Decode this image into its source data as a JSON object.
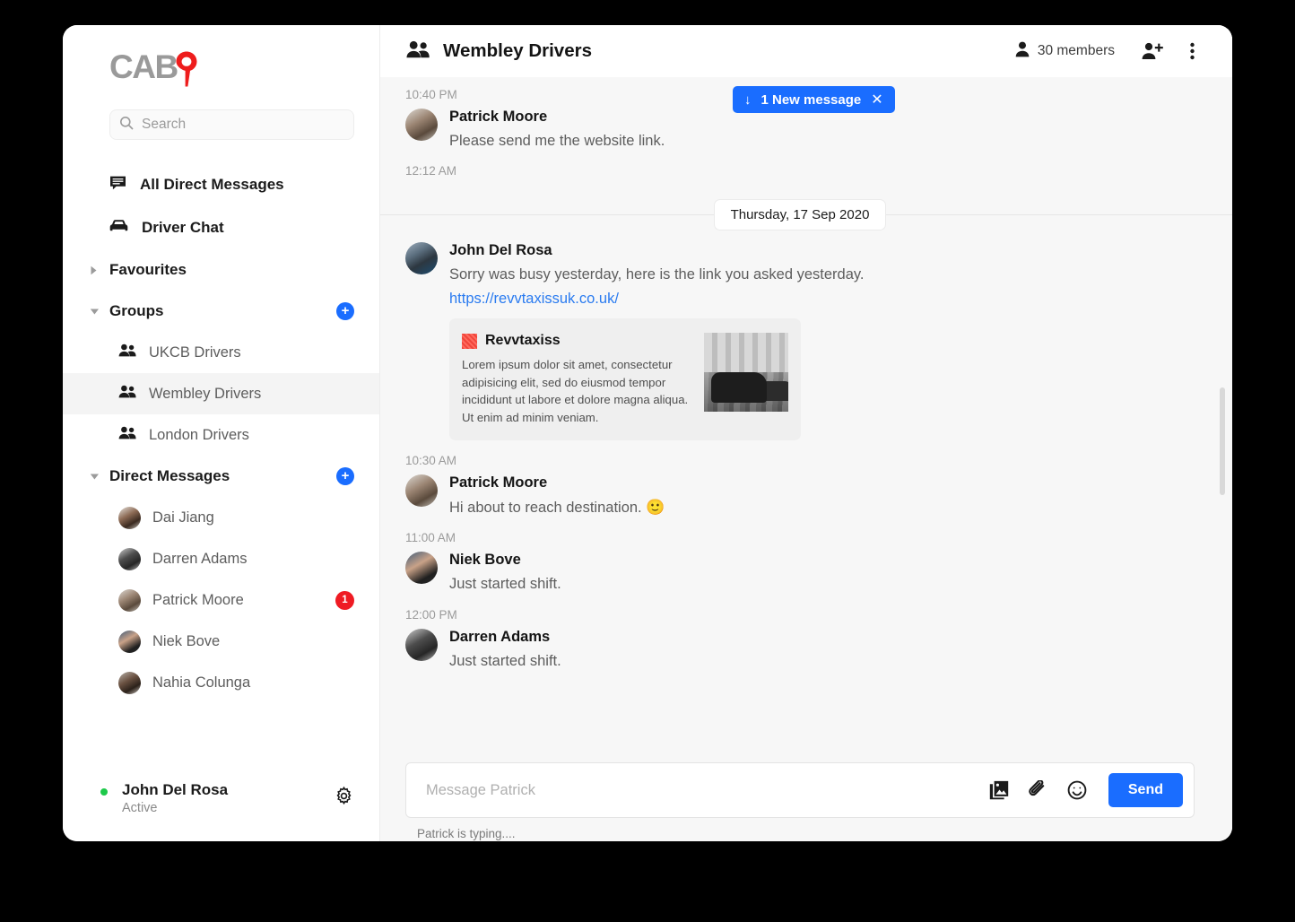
{
  "brand": {
    "logo_text": "CAB",
    "logo_accent": "9",
    "accent_color": "#1a6dff",
    "logo_pin_color": "#ee1d1d"
  },
  "sidebar": {
    "search": {
      "placeholder": "Search",
      "value": "",
      "icon": "search-icon"
    },
    "top_items": [
      {
        "label": "All Direct Messages",
        "icon": "chat-bubble-icon"
      },
      {
        "label": "Driver Chat",
        "icon": "car-icon"
      }
    ],
    "sections": [
      {
        "label": "Favourites",
        "expanded": false,
        "caret": "chevron-right-icon",
        "has_add": false
      },
      {
        "label": "Groups",
        "expanded": true,
        "caret": "chevron-down-icon",
        "has_add": true,
        "add_label": "+"
      },
      {
        "label": "Direct Messages",
        "expanded": true,
        "caret": "chevron-down-icon",
        "has_add": true,
        "add_label": "+"
      }
    ],
    "groups": [
      {
        "label": "UKCB Drivers",
        "selected": false
      },
      {
        "label": "Wembley Drivers",
        "selected": true
      },
      {
        "label": "London Drivers",
        "selected": false
      }
    ],
    "direct_messages": [
      {
        "name": "Dai Jiang",
        "badge": ""
      },
      {
        "name": "Darren Adams",
        "badge": ""
      },
      {
        "name": "Patrick Moore",
        "badge": "1"
      },
      {
        "name": "Niek Bove",
        "badge": ""
      },
      {
        "name": "Nahia Colunga",
        "badge": ""
      }
    ],
    "current_user": {
      "name": "John Del Rosa",
      "status": "Active",
      "status_color": "#1ec94a",
      "settings_icon": "gear-icon"
    }
  },
  "chat": {
    "header": {
      "icon": "group-icon",
      "title": "Wembley Drivers",
      "members_count": "30 members",
      "members_icon": "person-icon",
      "add_member_icon": "person-add-icon",
      "menu_icon": "kebab-menu-icon"
    },
    "new_message_banner": {
      "arrow": "↓",
      "label": "1 New message",
      "close": "✕"
    },
    "date_divider": "Thursday, 17 Sep 2020",
    "messages": [
      {
        "time_above": "10:40 PM",
        "sender": "Patrick Moore",
        "text": "Please send me the website link.",
        "time_below": "12:12 AM"
      },
      {
        "sender": "John Del Rosa",
        "text": "Sorry was busy yesterday, here is the link you asked yesterday.",
        "link": "https://revvtaxissuk.co.uk/",
        "time_below": "10:30 AM"
      },
      {
        "sender": "Patrick Moore",
        "text": "Hi about to reach destination.",
        "emoji": "🙂",
        "time_below": "11:00 AM"
      },
      {
        "sender": "Niek Bove",
        "text": "Just started shift.",
        "time_below": "12:00 PM"
      },
      {
        "sender": "Darren Adams",
        "text": "Just started shift."
      }
    ],
    "link_preview": {
      "favicon": "revvtaxiss-favicon",
      "title": "Revvtaxiss",
      "description": "Lorem ipsum dolor sit amet, consectetur adipisicing elit, sed do eiusmod tempor incididunt ut labore et dolore magna aliqua. Ut enim ad minim veniam.",
      "thumbnail": "london-taxi-photo"
    },
    "composer": {
      "placeholder": "Message Patrick",
      "value": "",
      "image_icon": "image-icon",
      "attach_icon": "paperclip-icon",
      "emoji_icon": "emoji-icon",
      "send_label": "Send"
    },
    "typing_status": "Patrick is typing...."
  }
}
